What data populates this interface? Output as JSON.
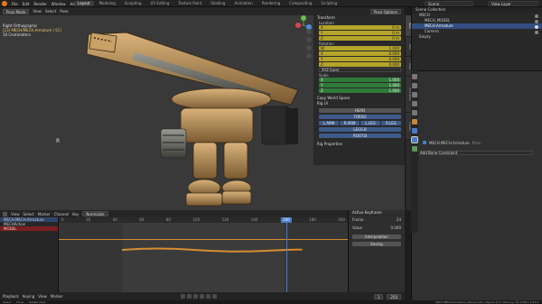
{
  "menu": [
    "File",
    "Edit",
    "Render",
    "Window",
    "Help"
  ],
  "workspaces": [
    "Layout",
    "Modeling",
    "Sculpting",
    "UV Editing",
    "Texture Paint",
    "Shading",
    "Animation",
    "Rendering",
    "Compositing",
    "Scripting"
  ],
  "active_workspace": "Layout",
  "scene": {
    "label": "Scene",
    "viewlayer": "View Layer"
  },
  "viewport": {
    "mode": "Pose Mode",
    "menu": [
      "View",
      "Select",
      "Pose"
    ],
    "overlay_line1": "Right Orthographic",
    "overlay_line2": "(23) MECH/MECH.Armature | SCI",
    "overlay_line3": "10 Centimeters",
    "corner_letter": "R",
    "pivot": "Pose Options"
  },
  "npanel": {
    "transform": "Transform",
    "location": "Location",
    "loc": [
      [
        "X",
        "0 m"
      ],
      [
        "Y",
        "0 m"
      ],
      [
        "Z",
        "0 m"
      ]
    ],
    "rotation": "Rotation",
    "rot": [
      [
        "W",
        "1.000"
      ],
      [
        "X",
        "0.000"
      ],
      [
        "Y",
        "0.000"
      ],
      [
        "Z",
        "0.000"
      ]
    ],
    "rotmode": "XYZ Euler",
    "scale": "Scale",
    "scl": [
      [
        "X",
        "1.000"
      ],
      [
        "Y",
        "1.000"
      ],
      [
        "Z",
        "1.000"
      ]
    ],
    "copy_space": "Copy World Space",
    "rig_id": "Rig UI",
    "rig_btn1": "HEAD",
    "rig_btn2": "TORSO",
    "rig_row": [
      "L.ARM",
      "R.ARM",
      "L.LEG",
      "R.LEG"
    ],
    "rig_btn3": "LEGS.B",
    "rig_btn4": "ROOT.B",
    "rig_props": "Rig Properties"
  },
  "vtabs": [
    "Item",
    "Tool",
    "View",
    "Animation",
    "Create"
  ],
  "outliner": {
    "title": "Scene Collection",
    "rows": [
      {
        "label": "MECH",
        "sel": false
      },
      {
        "label": "MECH_MODEL",
        "sel": false
      },
      {
        "label": "MECH.Armature",
        "sel": true
      },
      {
        "label": "Camera",
        "sel": false
      },
      {
        "label": "Empty",
        "sel": false
      }
    ]
  },
  "props": {
    "object": "MECH.MECH.Armature",
    "data": "Pose",
    "add_constraint": "Add Bone Constraint"
  },
  "timeline": {
    "menu": [
      "View",
      "Select",
      "Marker",
      "Channel",
      "Key"
    ],
    "mode": "Normalize",
    "tracks": [
      {
        "label": "MECH.MECH.Armature",
        "style": "blue"
      },
      {
        "label": "MECHAction",
        "style": "none"
      },
      {
        "label": "MODEL",
        "style": "red"
      }
    ],
    "ticks": [
      "0",
      "20",
      "40",
      "60",
      "80",
      "100",
      "120",
      "140",
      "160",
      "180",
      "200"
    ],
    "current_frame": "200",
    "side_title": "Active Keyframe",
    "side_rows": [
      [
        "Frame",
        "24"
      ],
      [
        "Value",
        "0.000"
      ]
    ],
    "side_btn1": "Interpolation",
    "side_btn2": "Easing",
    "frame_start": "1",
    "frame_end": "250",
    "playback": "Playback",
    "keying": "Keying",
    "view": "View",
    "marker": "Marker"
  },
  "status": {
    "left": "Select",
    "mid": "Move",
    "mid2": "Rotate View",
    "right": "MECH.MECH.Armature | Bones:1/8 | Objects:1/3 | Memory: 45.4 MiB | 2.83.0"
  },
  "colors": {
    "accent": "#e87d0d",
    "select": "#334d80",
    "keyframe": "#d68b2a",
    "playhead": "#4a7cc7",
    "field": "#b5a42a"
  }
}
